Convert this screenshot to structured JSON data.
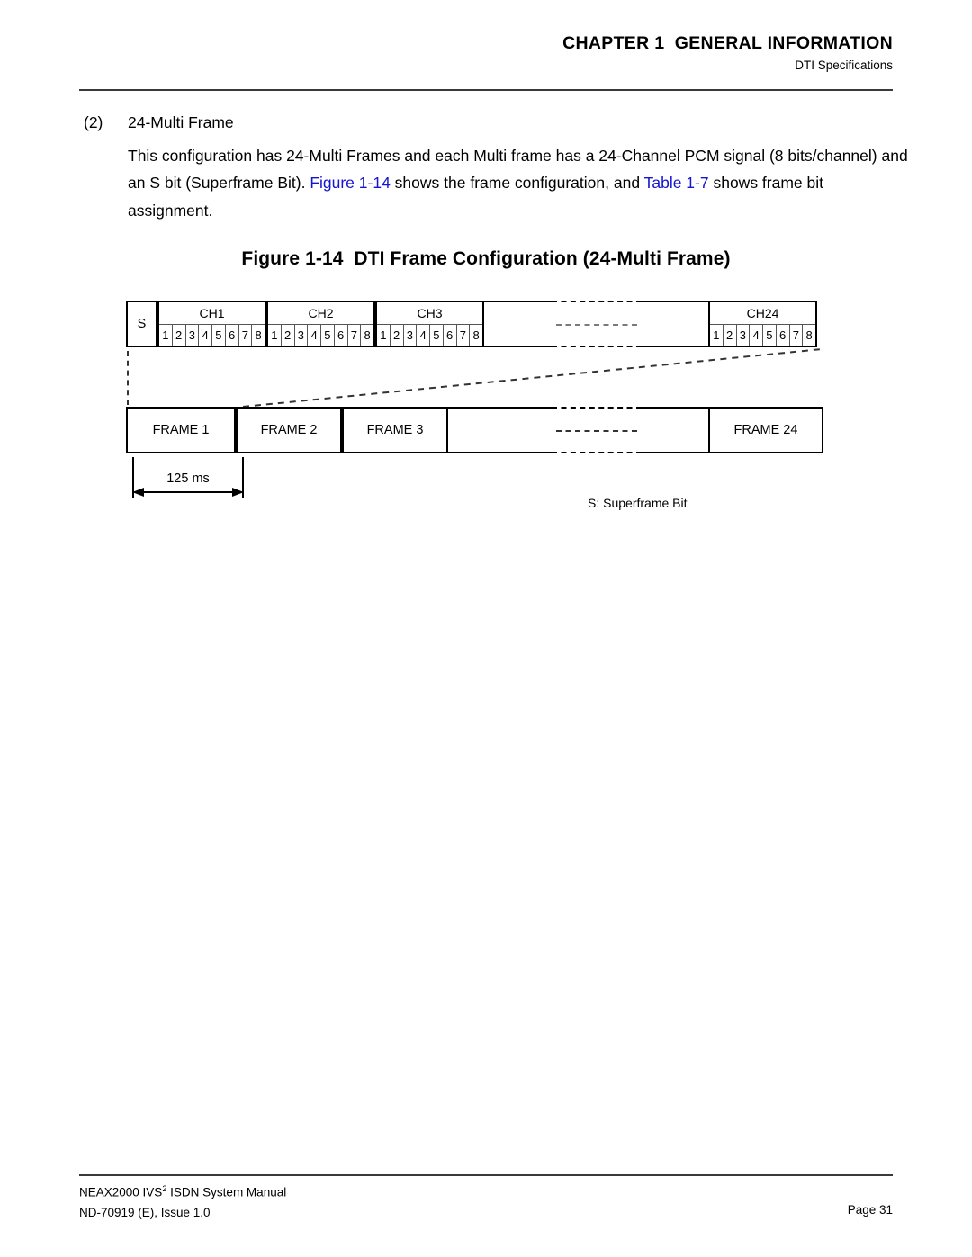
{
  "header": {
    "chapter": "CHAPTER 1  GENERAL INFORMATION",
    "subtitle": "DTI Specifications"
  },
  "section": {
    "number": "(2)",
    "title": "24-Multi Frame",
    "body_part1": "This configuration has 24-Multi Frames and each Multi frame has a 24-Channel PCM signal (8 bits/channel) and an S bit (Superframe Bit). ",
    "xref_figure": "Figure 1-14",
    "body_part2": " shows the frame configuration, and ",
    "xref_table": "Table 1-7",
    "body_part3": " shows frame bit assignment."
  },
  "figure": {
    "caption": "Figure 1-14  DTI Frame Configuration (24-Multi Frame)",
    "s_bit_label": "S",
    "bit_numbers": [
      "1",
      "2",
      "3",
      "4",
      "5",
      "6",
      "7",
      "8"
    ],
    "channels": [
      {
        "label": "CH1",
        "bits": [
          "1",
          "2",
          "3",
          "4",
          "5",
          "6",
          "7",
          "8"
        ]
      },
      {
        "label": "CH2",
        "bits": [
          "1",
          "2",
          "3",
          "4",
          "5",
          "6",
          "7",
          "8"
        ]
      },
      {
        "label": "CH3",
        "bits": [
          "1",
          "2",
          "3",
          "4",
          "5",
          "6",
          "7",
          "8"
        ]
      },
      {
        "label": "CH24",
        "bits": [
          "1",
          "2",
          "3",
          "4",
          "5",
          "6",
          "7",
          "8"
        ]
      }
    ],
    "frames": [
      {
        "label": "FRAME 1"
      },
      {
        "label": "FRAME 2"
      },
      {
        "label": "FRAME 3"
      },
      {
        "label": "FRAME 24"
      }
    ],
    "duration_label": "125 ms",
    "legend": "S: Superframe Bit"
  },
  "footer": {
    "manual_line_pre": "NEAX2000 IVS",
    "manual_line_sup": "2",
    "manual_line_post": " ISDN System Manual",
    "doc_line": "ND-70919 (E), Issue 1.0",
    "page": "Page 31"
  }
}
